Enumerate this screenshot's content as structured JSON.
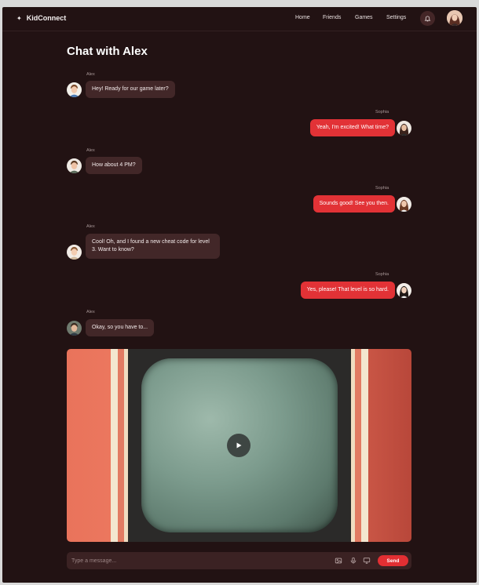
{
  "header": {
    "brand": "KidConnect",
    "nav": [
      "Home",
      "Friends",
      "Games",
      "Settings"
    ]
  },
  "chat": {
    "title": "Chat with Alex",
    "messages": [
      {
        "sender": "Alex",
        "text": "Hey! Ready for our game later?",
        "side": "left"
      },
      {
        "sender": "Sophia",
        "text": "Yeah, I'm excited! What time?",
        "side": "right"
      },
      {
        "sender": "Alex",
        "text": "How about 4 PM?",
        "side": "left"
      },
      {
        "sender": "Sophia",
        "text": "Sounds good! See you then.",
        "side": "right"
      },
      {
        "sender": "Alex",
        "text": "Cool! Oh, and I found a new cheat code for level 3. Want to know?",
        "side": "left"
      },
      {
        "sender": "Sophia",
        "text": "Yes, please! That level is so hard.",
        "side": "right"
      },
      {
        "sender": "Alex",
        "text": "Okay, so you have to...",
        "side": "left"
      }
    ]
  },
  "composer": {
    "placeholder": "Type a message...",
    "send_label": "Send"
  },
  "colors": {
    "background": "#221213",
    "accent": "#e23236",
    "bubble_left": "#422728"
  }
}
